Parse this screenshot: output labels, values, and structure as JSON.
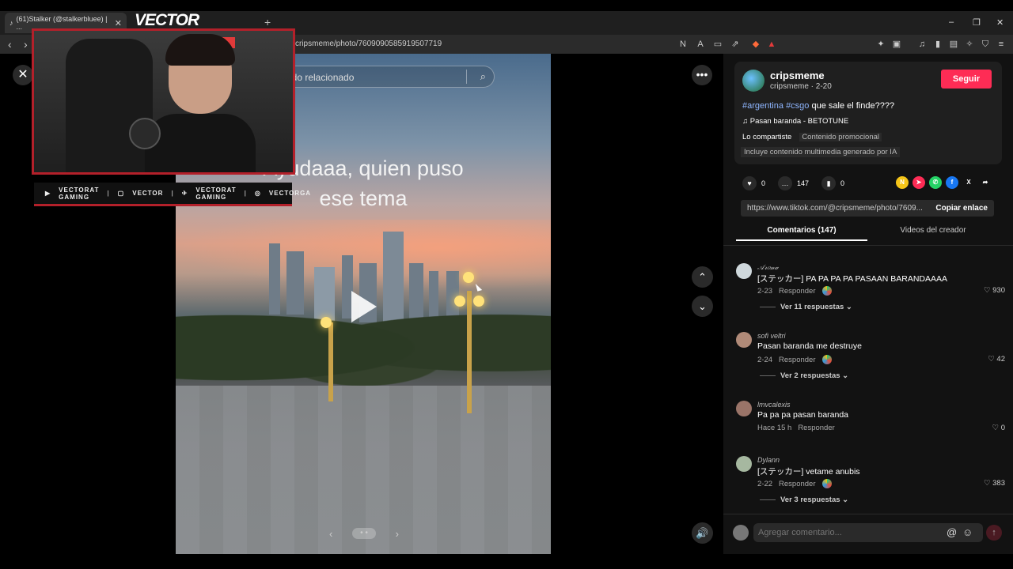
{
  "browser": {
    "tab_title": "(61)Stalker (@stalkerbluee) | ...",
    "new_tab": "+",
    "url": "cripsmeme/photo/7609090585919507719",
    "minimize": "–",
    "restore": "❐",
    "close": "✕"
  },
  "overlay": {
    "logo": "VECTOR",
    "red_sign": "",
    "social": [
      "VECTORAT GAMING",
      "VECTOR",
      "VECTORAT GAMING",
      "VECTORGA"
    ]
  },
  "video": {
    "search_placeholder": "ido relacionado",
    "caption_line1": "Ayudaaa, quien puso",
    "caption_line2": "ese tema",
    "pager_prev": "‹",
    "pager_dots": "• •",
    "pager_next": "›"
  },
  "controls": {
    "close": "✕",
    "more": "•••",
    "up": "⌃",
    "down": "⌄",
    "volume": "🔊"
  },
  "post": {
    "username": "cripsmeme",
    "sub": "cripsmeme · 2-20",
    "follow": "Seguir",
    "tag1": "#argentina",
    "tag2": "#csgo",
    "desc_rest": " que sale el finde????",
    "music": "♫  Pasan baranda - BETOTUNE",
    "shared": "Lo compartiste",
    "promo": "Contenido promocional",
    "ai": "Incluye contenido multimedia generado por IA",
    "likes": "0",
    "comments": "147",
    "saves": "0",
    "link": "https://www.tiktok.com/@cripsmeme/photo/7609...",
    "copy_link": "Copiar enlace"
  },
  "tabs": {
    "comments": "Comentarios (147)",
    "creator_videos": "Videos del creador"
  },
  "comments": [
    {
      "name": "𝒜𝓇𝑜𝓃𝒶",
      "text": "[ステッカー] PA PA PA PA PASAAN BARANDAAAA",
      "date": "2-23",
      "reply": "Responder",
      "likes": "♡ 930",
      "replies": "Ver 11 respuestas ⌄"
    },
    {
      "name": "sofi veltri",
      "text": "Pasan baranda me destruye",
      "date": "2-24",
      "reply": "Responder",
      "likes": "♡ 42",
      "replies": "Ver 2 respuestas ⌄"
    },
    {
      "name": "lmvcalexis",
      "text": "Pa pa pa pasan baranda",
      "date": "Hace 15 h",
      "reply": "Responder",
      "likes": "♡ 0",
      "replies": ""
    },
    {
      "name": "Dylann",
      "text": "[ステッカー] vetame anubis",
      "date": "2-22",
      "reply": "Responder",
      "likes": "♡ 383",
      "replies": "Ver 3 respuestas ⌄"
    }
  ],
  "input": {
    "placeholder": "Agregar comentario...",
    "at": "@",
    "emoji": "☺",
    "send": "↑"
  }
}
